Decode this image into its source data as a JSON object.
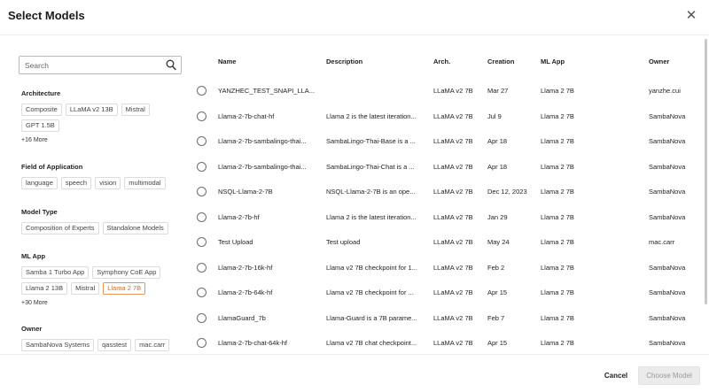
{
  "dialog": {
    "title": "Select Models",
    "close_icon": "close-icon"
  },
  "search": {
    "placeholder": "Search",
    "icon": "search-icon"
  },
  "facets": [
    {
      "title": "Architecture",
      "chips": [
        {
          "label": "Composite"
        },
        {
          "label": "LLaMA v2 13B"
        },
        {
          "label": "Mistral"
        },
        {
          "label": "GPT 1.5B"
        }
      ],
      "more": "+16 More"
    },
    {
      "title": "Field of Application",
      "chips": [
        {
          "label": "language"
        },
        {
          "label": "speech"
        },
        {
          "label": "vision"
        },
        {
          "label": "multimodal"
        }
      ]
    },
    {
      "title": "Model Type",
      "chips": [
        {
          "label": "Composition of Experts"
        },
        {
          "label": "Standalone Models"
        }
      ]
    },
    {
      "title": "ML App",
      "chips": [
        {
          "label": "Samba 1 Turbo App"
        },
        {
          "label": "Symphony CoE App"
        },
        {
          "label": "Llama 2 13B"
        },
        {
          "label": "Mistral"
        },
        {
          "label": "Llama 2 7B",
          "selected": true
        }
      ],
      "more": "+30 More"
    },
    {
      "title": "Owner",
      "chips": [
        {
          "label": "SambaNova Systems"
        },
        {
          "label": "qasstest"
        },
        {
          "label": "mac.carr"
        }
      ]
    }
  ],
  "table": {
    "columns": [
      "Name",
      "Description",
      "Arch.",
      "Creation",
      "ML App",
      "Owner"
    ],
    "rows": [
      [
        "YANZHEC_TEST_SNAPI_LLA...",
        "",
        "LLaMA v2 7B",
        "Mar 27",
        "Llama 2 7B",
        "yanzhe.cui"
      ],
      [
        "Llama-2-7b-chat-hf",
        "Llama 2 is the latest iteration...",
        "LLaMA v2 7B",
        "Jul 9",
        "Llama 2 7B",
        "SambaNova"
      ],
      [
        "Llama-2-7b-sambalingo-thai...",
        "SambaLingo-Thai-Base is a ...",
        "LLaMA v2 7B",
        "Apr 18",
        "Llama 2 7B",
        "SambaNova"
      ],
      [
        "Llama-2-7b-sambalingo-thai...",
        "SambaLingo-Thai-Chat is a ...",
        "LLaMA v2 7B",
        "Apr 18",
        "Llama 2 7B",
        "SambaNova"
      ],
      [
        "NSQL-Llama-2-7B",
        "NSQL-Llama-2-7B is an ope...",
        "LLaMA v2 7B",
        "Dec 12, 2023",
        "Llama 2 7B",
        "SambaNova"
      ],
      [
        "Llama-2-7b-hf",
        "Llama 2 is the latest iteration...",
        "LLaMA v2 7B",
        "Jan 29",
        "Llama 2 7B",
        "SambaNova"
      ],
      [
        "Test Upload",
        "Test upload",
        "LLaMA v2 7B",
        "May 24",
        "Llama 2 7B",
        "mac.carr"
      ],
      [
        "Llama-2-7b-16k-hf",
        "Llama v2 7B checkpoint for 1...",
        "LLaMA v2 7B",
        "Feb 2",
        "Llama 2 7B",
        "SambaNova"
      ],
      [
        "Llama-2-7b-64k-hf",
        "Llama v2 7B checkpoint for ...",
        "LLaMA v2 7B",
        "Apr 15",
        "Llama 2 7B",
        "SambaNova"
      ],
      [
        "LlamaGuard_7b",
        "Llama-Guard is a 7B parame...",
        "LLaMA v2 7B",
        "Feb 7",
        "Llama 2 7B",
        "SambaNova"
      ],
      [
        "Llama-2-7b-chat-64k-hf",
        "Llama v2 7B chat checkpoint...",
        "LLaMA v2 7B",
        "Apr 15",
        "Llama 2 7B",
        "SambaNova"
      ]
    ]
  },
  "footer": {
    "cancel_label": "Cancel",
    "choose_label": "Choose Model"
  },
  "colors": {
    "selected_chip_border": "#e7955a",
    "selected_chip_text": "#d06b25",
    "disabled_button_bg": "#ebebeb"
  }
}
